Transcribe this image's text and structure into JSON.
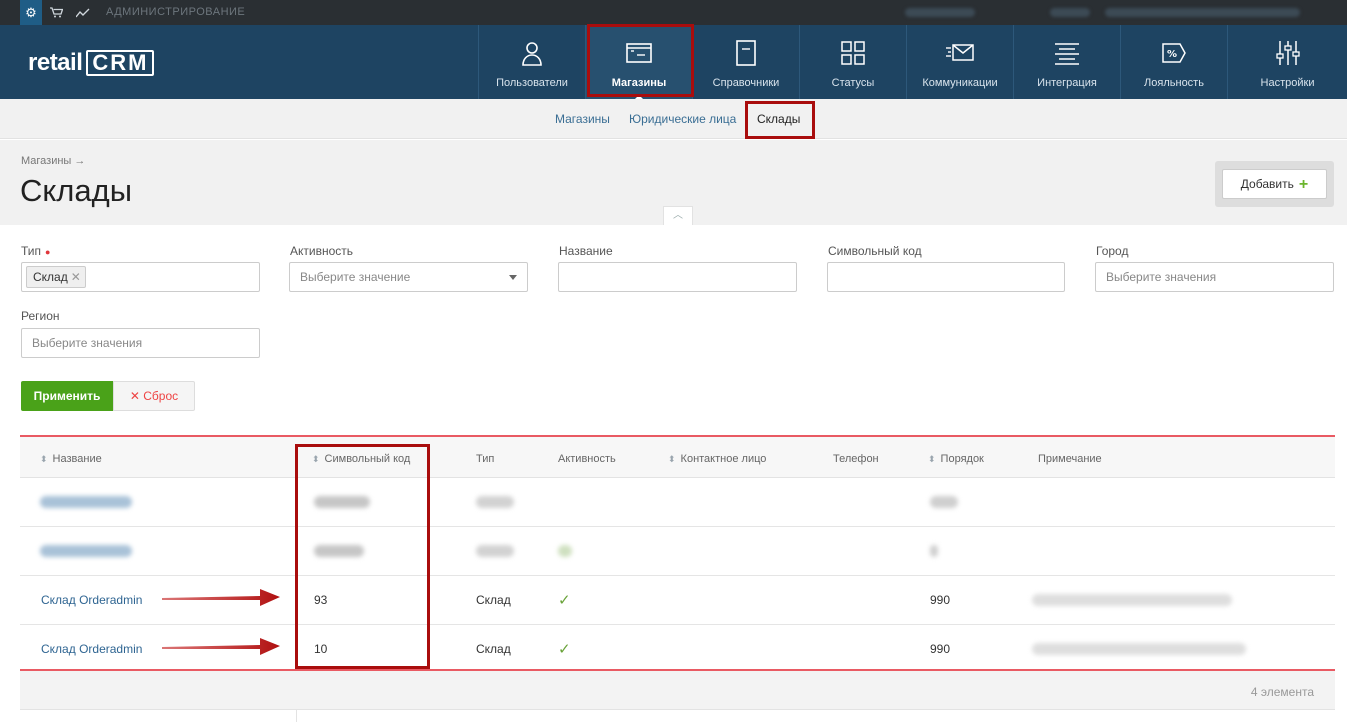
{
  "adminbar": {
    "title": "АДМИНИСТРИРОВАНИЕ",
    "icons": [
      "gear-icon",
      "cart-icon",
      "chart-icon"
    ]
  },
  "header": {
    "logo_text": "retail",
    "logo_crm": "CRM",
    "nav": [
      {
        "label": "Пользователи",
        "icon": "user-icon"
      },
      {
        "label": "Магазины",
        "icon": "store-icon",
        "active": true
      },
      {
        "label": "Справочники",
        "icon": "book-icon"
      },
      {
        "label": "Статусы",
        "icon": "statuses-icon"
      },
      {
        "label": "Коммуникации",
        "icon": "envelope-icon"
      },
      {
        "label": "Интеграция",
        "icon": "integration-icon"
      },
      {
        "label": "Лояльность",
        "icon": "percent-tag-icon"
      },
      {
        "label": "Настройки",
        "icon": "sliders-icon"
      }
    ]
  },
  "subnav": {
    "items": [
      "Магазины",
      "Юридические лица",
      "Склады"
    ],
    "active": "Склады"
  },
  "page": {
    "breadcrumb": "Магазины →",
    "title": "Склады",
    "add_label": "Добавить",
    "add_icon": "plus-icon"
  },
  "filters": {
    "type_label": "Тип",
    "type_value": "Склад",
    "activity_label": "Активность",
    "activity_placeholder": "Выберите значение",
    "name_label": "Название",
    "code_label": "Символьный код",
    "city_label": "Город",
    "city_placeholder": "Выберите значения",
    "region_label": "Регион",
    "region_placeholder": "Выберите значения",
    "apply_label": "Применить",
    "reset_label": "Сброс"
  },
  "table": {
    "columns": [
      "Название",
      "Символьный код",
      "Тип",
      "Активность",
      "Контактное лицо",
      "Телефон",
      "Порядок",
      "Примечание"
    ],
    "rows": [
      {
        "name": "Склад Orderadmin",
        "code": "93",
        "type": "Склад",
        "active": true,
        "order": "990"
      },
      {
        "name": "Склад Orderadmin",
        "code": "10",
        "type": "Склад",
        "active": true,
        "order": "990"
      }
    ],
    "count_label": "4 элемента"
  },
  "colors": {
    "header_bg": "#1e4462",
    "accent_red": "#a90d0d",
    "apply_green": "#4aa219",
    "link_blue": "#2f6592"
  }
}
